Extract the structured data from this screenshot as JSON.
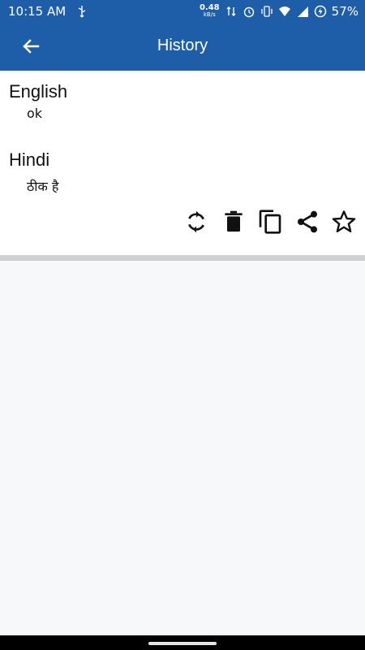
{
  "status_bar": {
    "time": "10:15 AM",
    "net_speed_value": "0.48",
    "net_speed_unit": "kB/s",
    "battery_percent": "57%",
    "icons": [
      "usb-icon",
      "alarm-icon",
      "vibrate-icon",
      "wifi-icon",
      "signal-icon",
      "battery-saver-icon"
    ]
  },
  "app_bar": {
    "title": "History",
    "back_icon": "arrow-back-icon"
  },
  "history_item": {
    "source_language": "English",
    "source_text": "ok",
    "target_language": "Hindi",
    "target_text": "ठीक है",
    "actions": [
      {
        "name": "refresh",
        "icon": "refresh-icon"
      },
      {
        "name": "delete",
        "icon": "trash-icon"
      },
      {
        "name": "copy",
        "icon": "copy-icon"
      },
      {
        "name": "share",
        "icon": "share-icon"
      },
      {
        "name": "favorite",
        "icon": "star-outline-icon"
      }
    ]
  },
  "colors": {
    "primary": "#1e5ea8",
    "background": "#f7f8fa",
    "divider": "#cfd0d2"
  }
}
